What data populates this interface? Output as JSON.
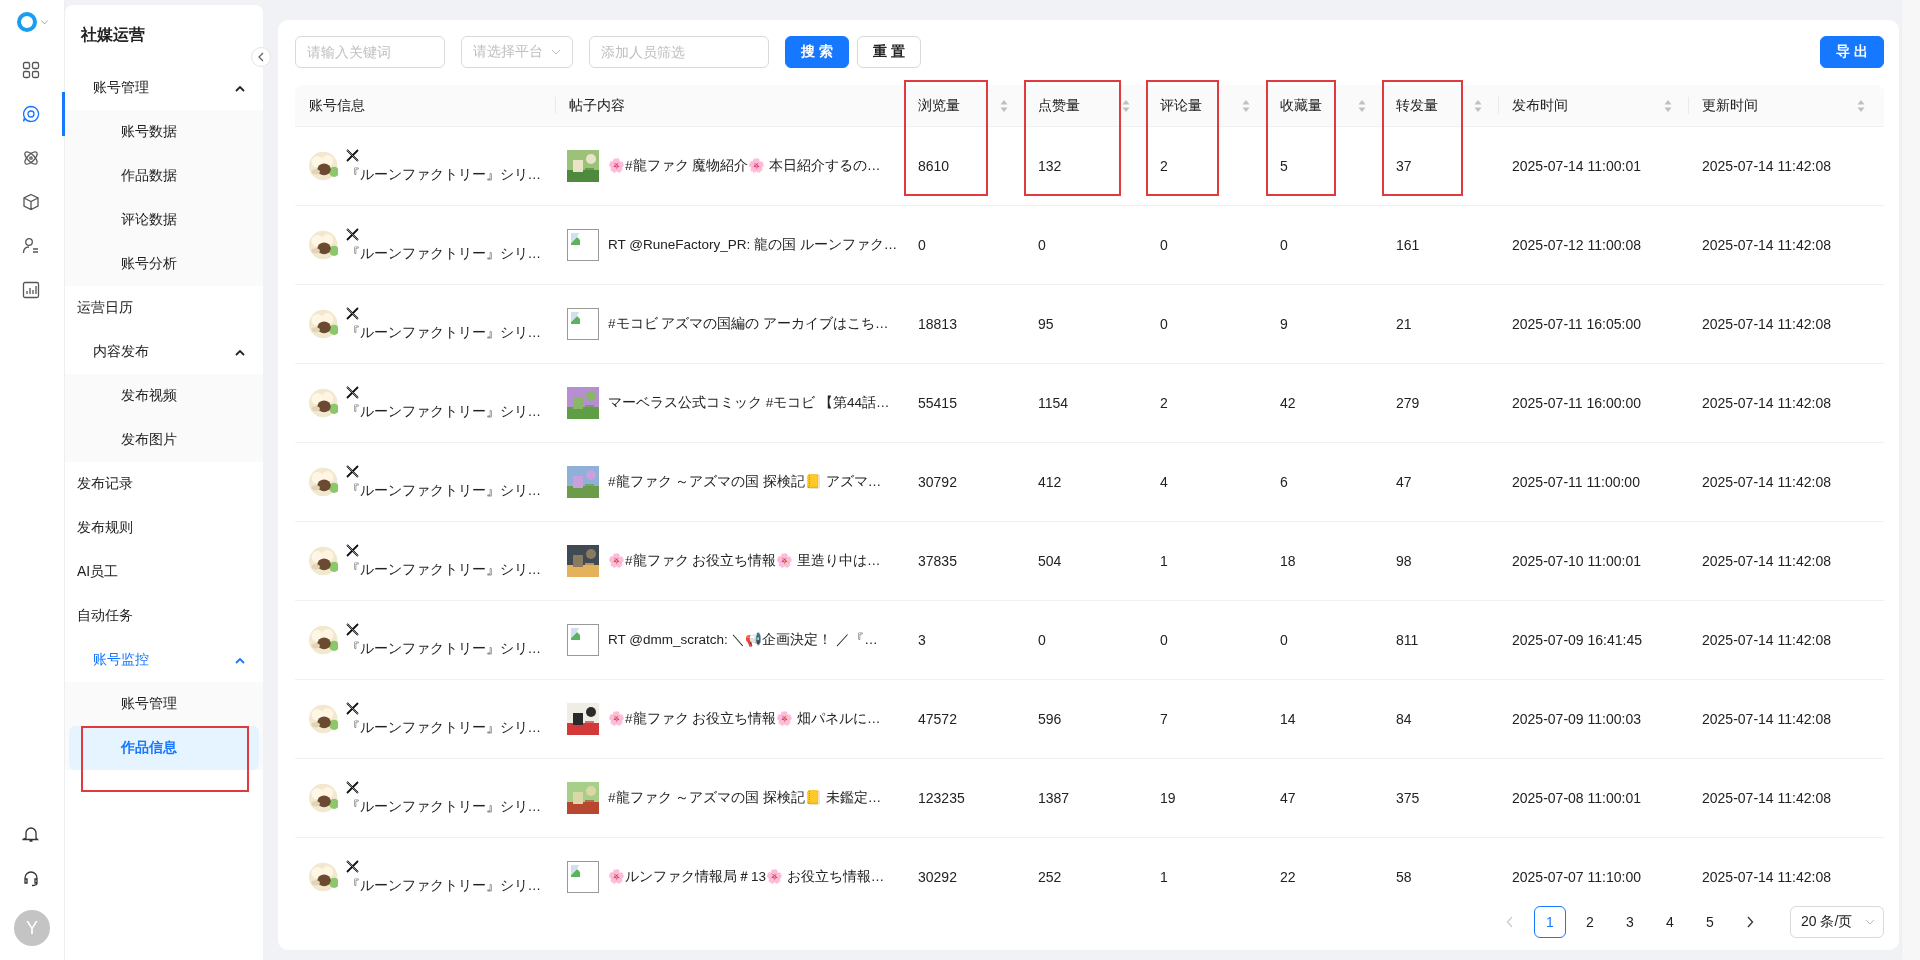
{
  "rail": {
    "items": [
      {
        "kind": "grid",
        "selected": false
      },
      {
        "kind": "chat",
        "selected": true
      },
      {
        "kind": "atom",
        "selected": false
      },
      {
        "kind": "cube",
        "selected": false
      },
      {
        "kind": "person-list",
        "selected": false
      },
      {
        "kind": "chart",
        "selected": false
      }
    ],
    "bottom": [
      {
        "kind": "bell"
      },
      {
        "kind": "headset"
      }
    ],
    "avatar": "Y"
  },
  "sidebar": {
    "title": "社媒运营",
    "items": [
      {
        "label": "账号管理",
        "selected": false,
        "expanded": true,
        "children": [
          {
            "label": "账号数据",
            "selected": false,
            "highlighted": false
          },
          {
            "label": "作品数据",
            "selected": false,
            "highlighted": false
          },
          {
            "label": "评论数据",
            "selected": false,
            "highlighted": false
          },
          {
            "label": "账号分析",
            "selected": false,
            "highlighted": false
          }
        ]
      },
      {
        "label": "运营日历",
        "selected": false
      },
      {
        "label": "内容发布",
        "selected": false,
        "expanded": true,
        "children": [
          {
            "label": "发布视频",
            "selected": false,
            "highlighted": false
          },
          {
            "label": "发布图片",
            "selected": false,
            "highlighted": false
          }
        ]
      },
      {
        "label": "发布记录",
        "selected": false
      },
      {
        "label": "发布规则",
        "selected": false
      },
      {
        "label": "AI员工",
        "selected": false
      },
      {
        "label": "自动任务",
        "selected": false
      },
      {
        "label": "账号监控",
        "selected": true,
        "expanded": true,
        "children": [
          {
            "label": "账号管理",
            "selected": false,
            "highlighted": false
          },
          {
            "label": "作品信息",
            "selected": true,
            "highlighted": true
          }
        ]
      }
    ]
  },
  "filters": {
    "keyword": {
      "placeholder": "请输入关键词"
    },
    "platform": {
      "placeholder": "请选择平台"
    },
    "person": {
      "placeholder": "添加人员筛选"
    },
    "search_button": "搜 索",
    "reset_button": "重 置",
    "export_button": "导 出"
  },
  "table": {
    "columns": [
      {
        "label": "账号信息",
        "sortable": false,
        "highlighted": false
      },
      {
        "label": "帖子内容",
        "sortable": false,
        "highlighted": false
      },
      {
        "label": "浏览量",
        "sortable": true,
        "highlighted": true
      },
      {
        "label": "点赞量",
        "sortable": true,
        "highlighted": true
      },
      {
        "label": "评论量",
        "sortable": true,
        "highlighted": true
      },
      {
        "label": "收藏量",
        "sortable": true,
        "highlighted": true
      },
      {
        "label": "转发量",
        "sortable": true,
        "highlighted": true
      },
      {
        "label": "发布时间",
        "sortable": true,
        "highlighted": false
      },
      {
        "label": "更新时间",
        "sortable": true,
        "highlighted": false
      }
    ],
    "rows": [
      {
        "account": "『ルーンファクトリー』シリ…",
        "content": "🌸#龍ファク 魔物紹介🌸 本日紹介するの…",
        "views": "8610",
        "likes": "132",
        "comments": "2",
        "favorites": "5",
        "shares": "37",
        "published": "2025-07-14 11:00:01",
        "updated": "2025-07-14 11:42:08"
      },
      {
        "account": "『ルーンファクトリー』シリ…",
        "thumbnail": {
          "kind": "broken"
        },
        "content": "RT @RuneFactory_PR: 龍の国 ルーンファク…",
        "views": "0",
        "likes": "0",
        "comments": "0",
        "favorites": "0",
        "shares": "161",
        "published": "2025-07-12 11:00:08",
        "updated": "2025-07-14 11:42:08"
      },
      {
        "account": "『ルーンファクトリー』シリ…",
        "thumbnail": {
          "kind": "broken"
        },
        "content": "#モコビ アズマの国編の アーカイブはこち…",
        "views": "18813",
        "likes": "95",
        "comments": "0",
        "favorites": "9",
        "shares": "21",
        "published": "2025-07-11 16:05:00",
        "updated": "2025-07-14 11:42:08"
      },
      {
        "account": "『ルーンファクトリー』シリ…",
        "content": "マーベラス公式コミック #モコビ 【第44話…",
        "views": "55415",
        "likes": "1154",
        "comments": "2",
        "favorites": "42",
        "shares": "279",
        "published": "2025-07-11 16:00:00",
        "updated": "2025-07-14 11:42:08"
      },
      {
        "account": "『ルーンファクトリー』シリ…",
        "content": "#龍ファク ～アズマの国 探検記📒 アズマ…",
        "views": "30792",
        "likes": "412",
        "comments": "4",
        "favorites": "6",
        "shares": "47",
        "published": "2025-07-11 11:00:00",
        "updated": "2025-07-14 11:42:08"
      },
      {
        "account": "『ルーンファクトリー』シリ…",
        "content": "🌸#龍ファク お役立ち情報🌸 里造り中は…",
        "views": "37835",
        "likes": "504",
        "comments": "1",
        "favorites": "18",
        "shares": "98",
        "published": "2025-07-10 11:00:01",
        "updated": "2025-07-14 11:42:08"
      },
      {
        "account": "『ルーンファクトリー』シリ…",
        "thumbnail": {
          "kind": "broken"
        },
        "content": "RT @dmm_scratch: ＼📢企画決定！ ／『…",
        "views": "3",
        "likes": "0",
        "comments": "0",
        "favorites": "0",
        "shares": "811",
        "published": "2025-07-09 16:41:45",
        "updated": "2025-07-14 11:42:08"
      },
      {
        "account": "『ルーンファクトリー』シリ…",
        "content": "🌸#龍ファク お役立ち情報🌸 畑パネルに…",
        "views": "47572",
        "likes": "596",
        "comments": "7",
        "favorites": "14",
        "shares": "84",
        "published": "2025-07-09 11:00:03",
        "updated": "2025-07-14 11:42:08"
      },
      {
        "account": "『ルーンファクトリー』シリ…",
        "content": "#龍ファク ～アズマの国 探検記📒 未鑑定…",
        "views": "123235",
        "likes": "1387",
        "comments": "19",
        "favorites": "47",
        "shares": "375",
        "published": "2025-07-08 11:00:01",
        "updated": "2025-07-14 11:42:08"
      },
      {
        "account": "『ルーンファクトリー』シリ…",
        "thumbnail": {
          "kind": "broken"
        },
        "content": "🌸ルンファク情報局＃13🌸 お役立ち情報…",
        "views": "30292",
        "likes": "252",
        "comments": "1",
        "favorites": "22",
        "shares": "58",
        "published": "2025-07-07 11:10:00",
        "updated": "2025-07-14 11:42:08"
      }
    ]
  },
  "pagination": {
    "prev_disabled": true,
    "next_disabled": false,
    "pages": [
      {
        "label": "1",
        "selected": true
      },
      {
        "label": "2",
        "selected": false
      },
      {
        "label": "3",
        "selected": false
      },
      {
        "label": "4",
        "selected": false
      },
      {
        "label": "5",
        "selected": false
      }
    ],
    "page_size": "20 条/页"
  }
}
